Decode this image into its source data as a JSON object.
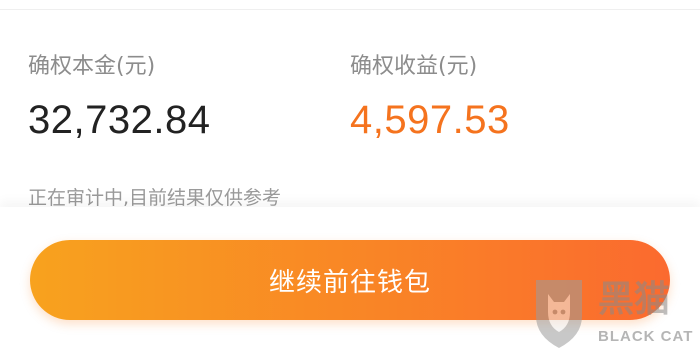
{
  "summary": {
    "principal": {
      "label": "确权本金(元)",
      "value": "32,732.84"
    },
    "earnings": {
      "label": "确权收益(元)",
      "value": "4,597.53"
    },
    "note": "正在审计中,目前结果仅供参考"
  },
  "action": {
    "continue_label": "继续前往钱包"
  },
  "watermark": {
    "brand_cn": "黑猫",
    "brand_en": "BLACK CAT"
  },
  "colors": {
    "accent": "#f5731e",
    "button_gradient_start": "#f8a21e",
    "button_gradient_end": "#fb6a2f",
    "primary_text": "#222222",
    "secondary_text": "#8c8c8c"
  }
}
